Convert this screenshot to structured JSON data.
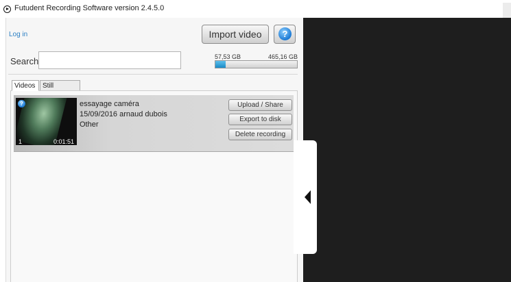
{
  "window": {
    "title": "Futudent Recording Software version 2.4.5.0",
    "icon": "record-play-icon"
  },
  "header": {
    "login_label": "Log in",
    "import_label": "Import video",
    "help_icon": "question-mark-icon",
    "help_glyph": "?"
  },
  "search": {
    "label": "Search",
    "value": "",
    "placeholder": ""
  },
  "storage": {
    "used": "57,53 GB",
    "total": "465,16 GB",
    "fraction_used": 0.1237
  },
  "tabs": [
    {
      "label": "Videos",
      "active": true
    },
    {
      "label": "Still images",
      "active": false
    }
  ],
  "videos": [
    {
      "title": "essayage caméra",
      "meta": "15/09/2016 arnaud dubois",
      "category": "Other",
      "index": "1",
      "duration": "0:01:51",
      "badge_glyph": "?",
      "actions": {
        "upload": "Upload / Share",
        "export": "Export to disk",
        "delete": "Delete recording"
      }
    }
  ],
  "colors": {
    "accent": "#2b7fc4",
    "storage_fill": "#1a8ac6",
    "dark_panel": "#1e1e1e"
  }
}
